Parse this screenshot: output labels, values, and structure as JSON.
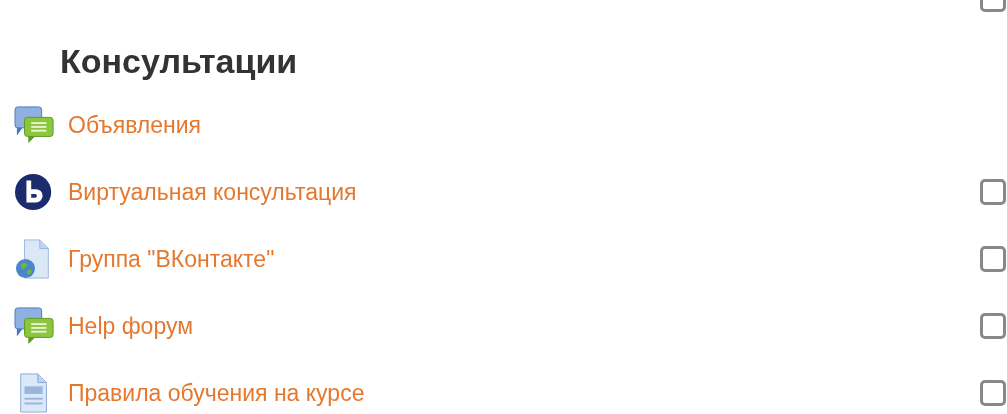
{
  "previous_section": {
    "checked": false
  },
  "section": {
    "title": "Консультации",
    "activities": [
      {
        "kind": "forum",
        "label": "Объявления"
      },
      {
        "kind": "conference",
        "label": "Виртуальная консультация",
        "checked": false
      },
      {
        "kind": "url",
        "label": "Группа \"ВКонтакте\"",
        "checked": false
      },
      {
        "kind": "forum",
        "label": "Help форум",
        "checked": false
      },
      {
        "kind": "page",
        "label": "Правила обучения на курсе",
        "checked": false
      }
    ]
  }
}
